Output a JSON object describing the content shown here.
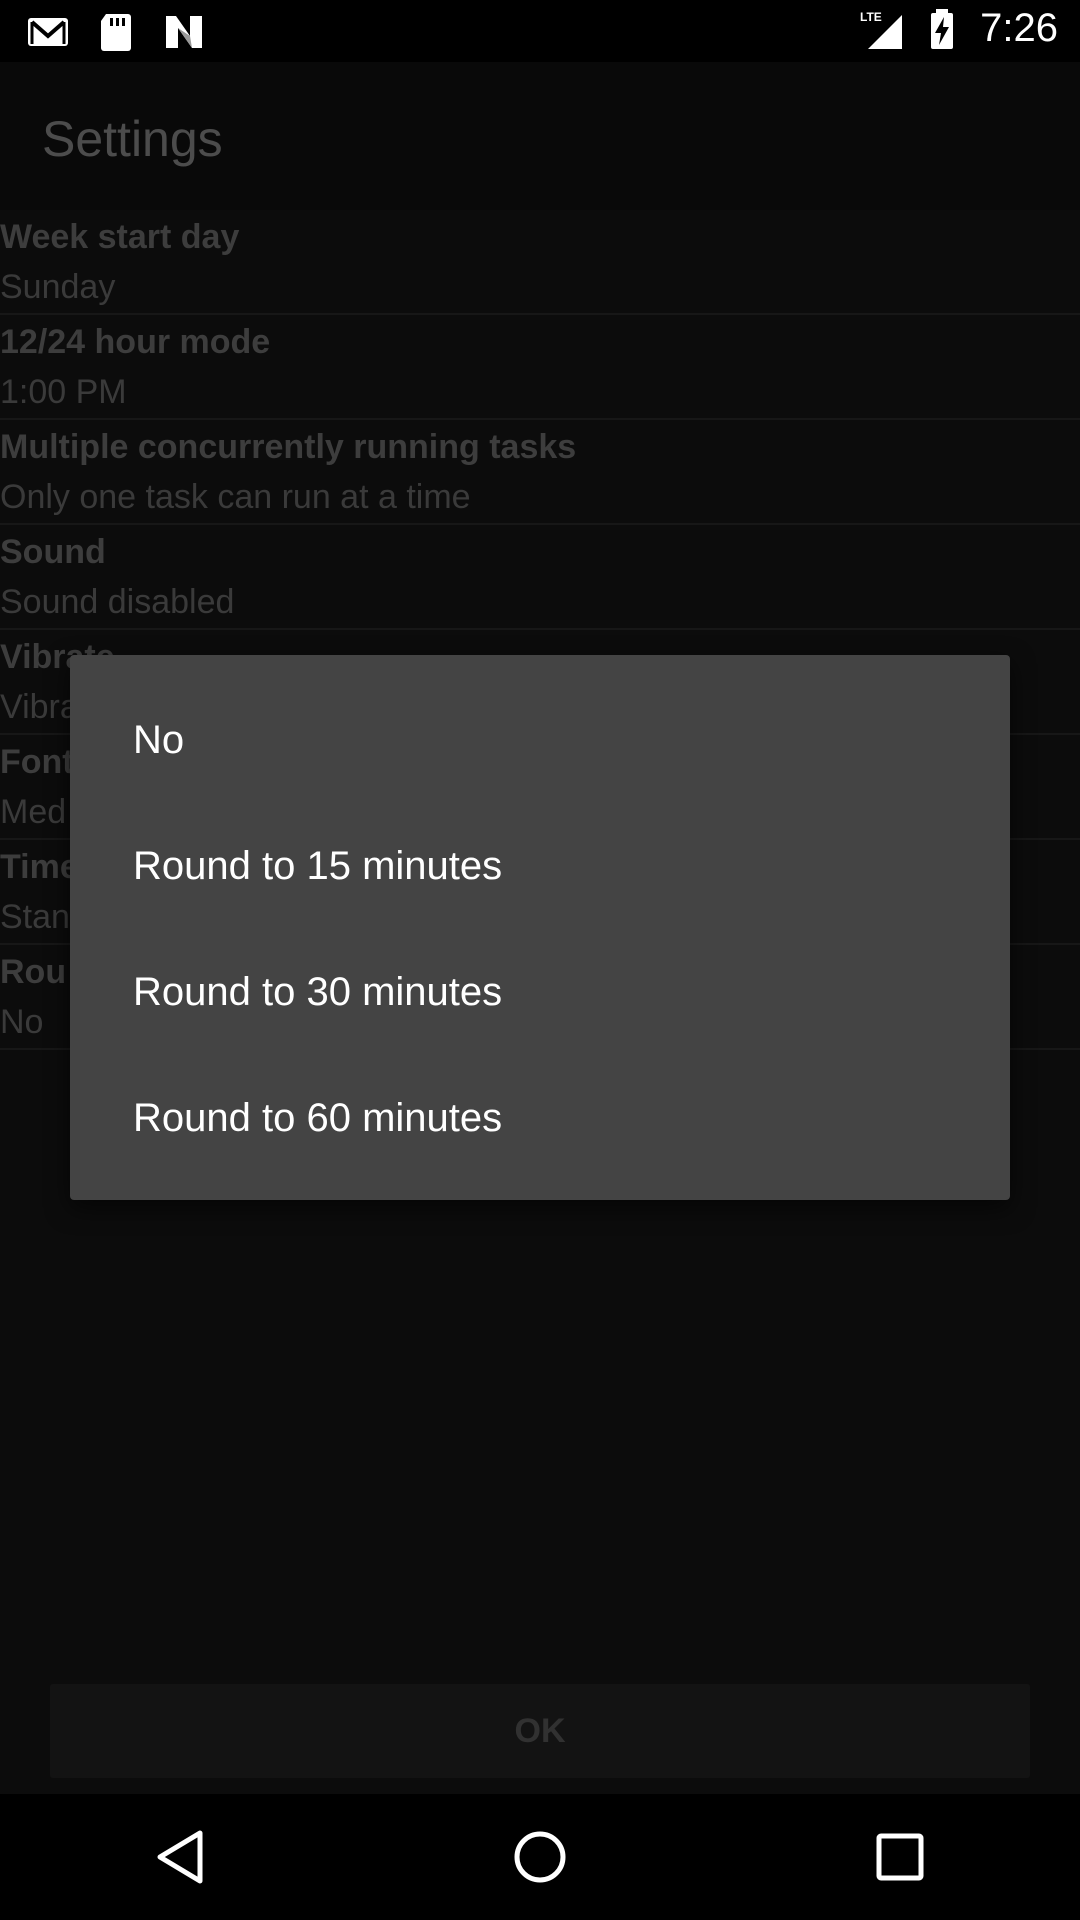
{
  "status_bar": {
    "time": "7:26",
    "network": "LTE",
    "icons": [
      "gmail-icon",
      "sd-card-icon",
      "n-icon",
      "lte-signal-icon",
      "battery-charging-icon"
    ]
  },
  "appbar": {
    "title": "Settings"
  },
  "settings": [
    {
      "title": "Week start day",
      "summary": "Sunday"
    },
    {
      "title": "12/24 hour mode",
      "summary": "1:00 PM"
    },
    {
      "title": "Multiple concurrently running tasks",
      "summary": "Only one task can run at a time"
    },
    {
      "title": "Sound",
      "summary": "Sound disabled"
    },
    {
      "title": "Vibrate",
      "summary": "Vibra"
    },
    {
      "title": "Font",
      "summary": "Med"
    },
    {
      "title": "Time",
      "summary": "Stan"
    },
    {
      "title": "Rou",
      "summary": "No"
    }
  ],
  "dialog": {
    "options": [
      "No",
      "Round to 15 minutes",
      "Round to 30 minutes",
      "Round to 60 minutes"
    ]
  },
  "ok_button": {
    "label": "OK"
  },
  "colors": {
    "dialog_bg": "#444444",
    "app_bg": "#161616",
    "status_bar_bg": "#000000"
  }
}
